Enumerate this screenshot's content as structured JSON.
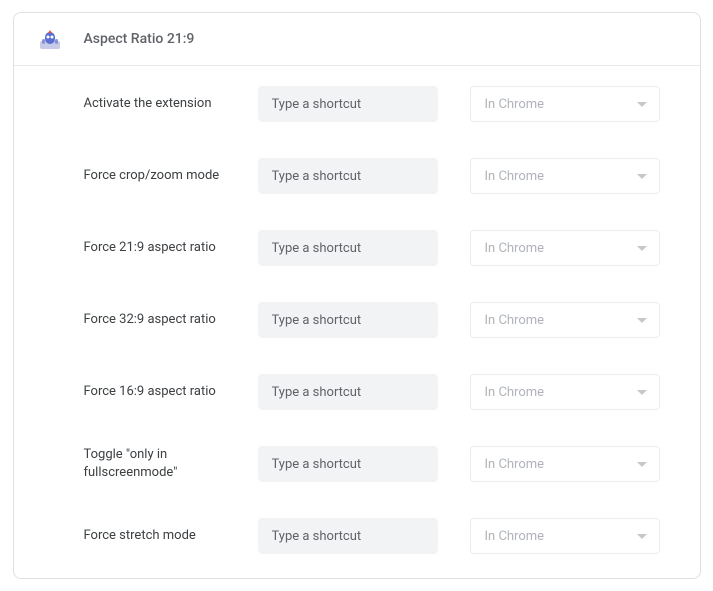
{
  "header": {
    "title": "Aspect Ratio 21:9"
  },
  "placeholder": "Type a shortcut",
  "scope_default": "In Chrome",
  "rows": [
    {
      "label": "Activate the extension"
    },
    {
      "label": "Force crop/zoom mode"
    },
    {
      "label": "Force 21:9 aspect ratio"
    },
    {
      "label": "Force 32:9 aspect ratio"
    },
    {
      "label": "Force 16:9 aspect ratio"
    },
    {
      "label": "Toggle \"only in fullscreenmode\""
    },
    {
      "label": "Force stretch mode"
    }
  ]
}
